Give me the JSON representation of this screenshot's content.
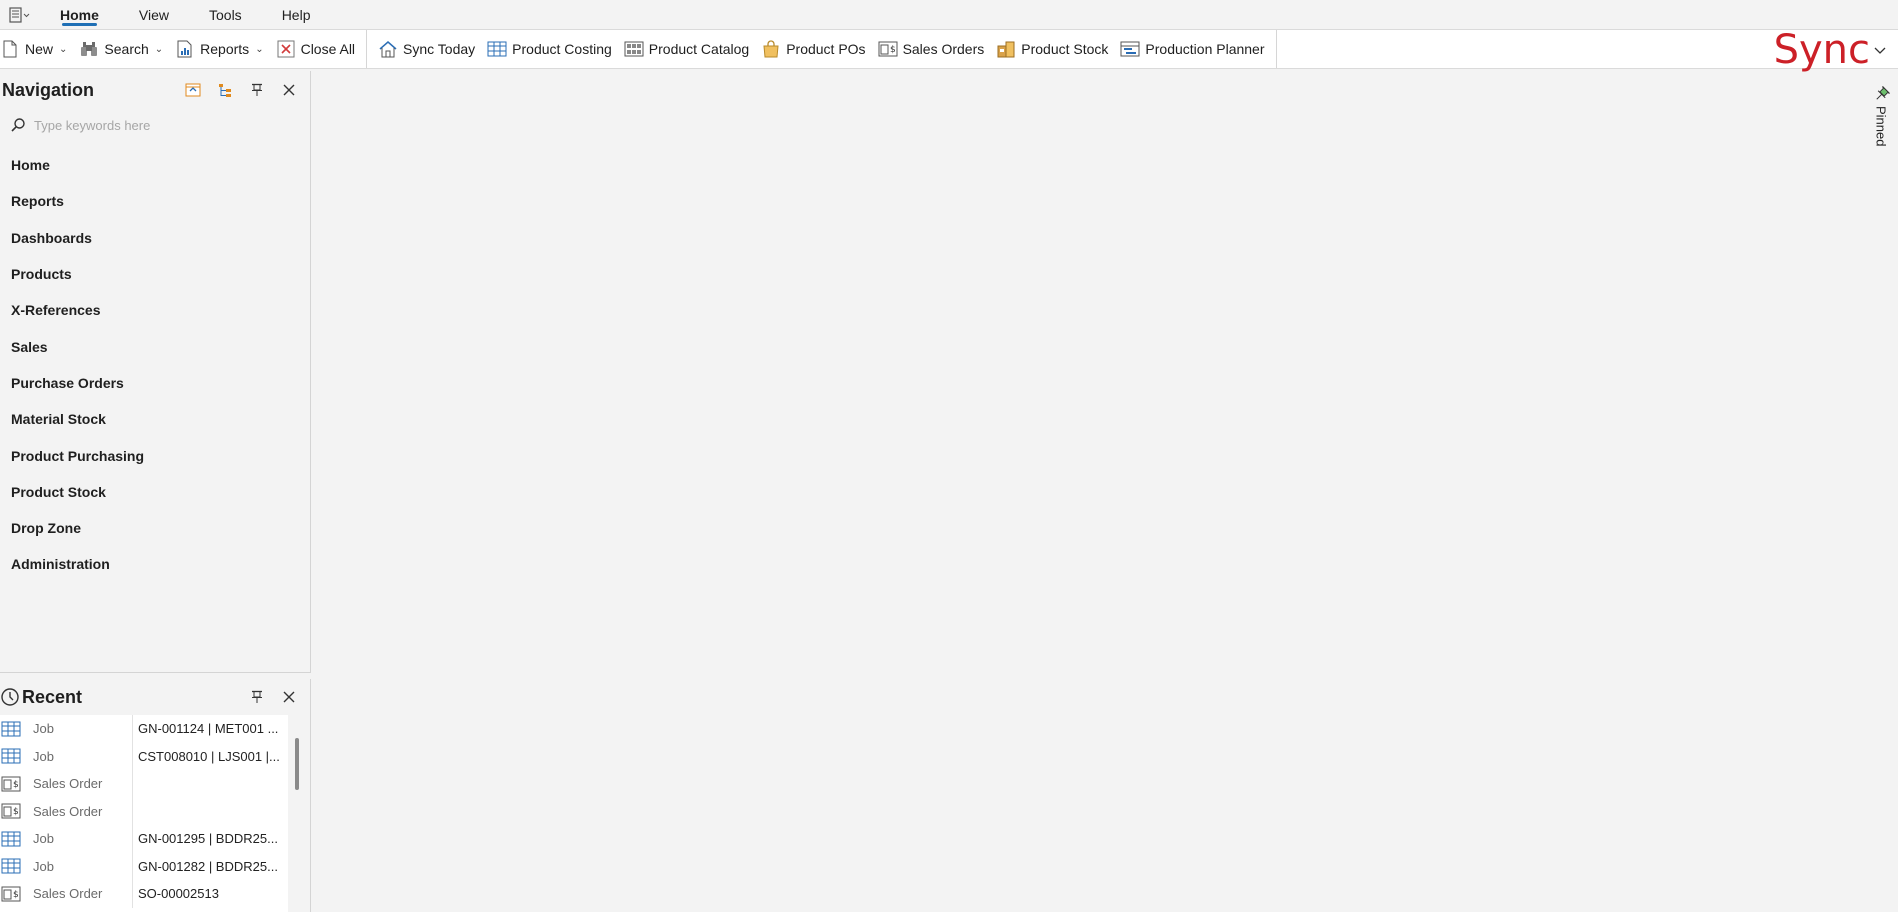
{
  "menubar": {
    "tabs": [
      {
        "label": "Home",
        "active": true
      },
      {
        "label": "View",
        "active": false
      },
      {
        "label": "Tools",
        "active": false
      },
      {
        "label": "Help",
        "active": false
      }
    ]
  },
  "toolbar": {
    "new_label": "New",
    "search_label": "Search",
    "reports_label": "Reports",
    "close_all_label": "Close All",
    "sync_today_label": "Sync Today",
    "product_costing_label": "Product Costing",
    "product_catalog_label": "Product Catalog",
    "product_pos_label": "Product POs",
    "sales_orders_label": "Sales Orders",
    "product_stock_label": "Product Stock",
    "production_planner_label": "Production Planner"
  },
  "logo": {
    "text": "Sync",
    "color": "#cc2027"
  },
  "navigation": {
    "title": "Navigation",
    "search_placeholder": "Type keywords here",
    "items": [
      "Home",
      "Reports",
      "Dashboards",
      "Products",
      "X-References",
      "Sales",
      "Purchase Orders",
      "Material Stock",
      "Product Purchasing",
      "Product Stock",
      "Drop Zone",
      "Administration"
    ]
  },
  "recent": {
    "title": "Recent",
    "rows": [
      {
        "icon": "grid-icon",
        "type": "Job",
        "desc": "GN-001124 | MET001 ..."
      },
      {
        "icon": "grid-icon",
        "type": "Job",
        "desc": "CST008010 | LJS001 |..."
      },
      {
        "icon": "sales-order-icon",
        "type": "Sales Order",
        "desc": ""
      },
      {
        "icon": "sales-order-icon",
        "type": "Sales Order",
        "desc": ""
      },
      {
        "icon": "grid-icon",
        "type": "Job",
        "desc": "GN-001295 |  BDDR25..."
      },
      {
        "icon": "grid-icon",
        "type": "Job",
        "desc": "GN-001282 |  BDDR25..."
      },
      {
        "icon": "sales-order-icon",
        "type": "Sales Order",
        "desc": "SO-00002513"
      }
    ]
  },
  "pinned": {
    "label": "Pinned"
  },
  "colors": {
    "accent": "#1f6fb5",
    "brand": "#cc2027"
  }
}
